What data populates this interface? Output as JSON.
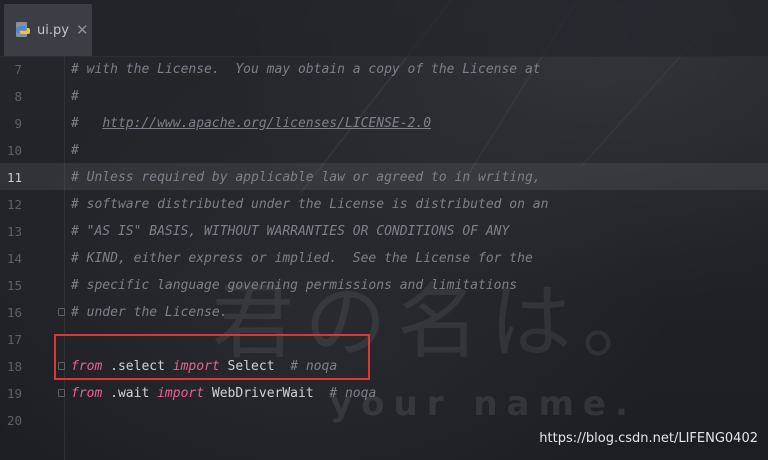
{
  "editor": {
    "tab": {
      "label": "ui.py",
      "close_glyph": "✕",
      "icon": "python-file-icon"
    },
    "current_line": 11,
    "lines": [
      {
        "num": "7",
        "tokens": [
          {
            "cls": "cm",
            "text": "# with the License.  You may obtain a copy of the License at"
          }
        ]
      },
      {
        "num": "8",
        "tokens": [
          {
            "cls": "cm",
            "text": "#"
          }
        ]
      },
      {
        "num": "9",
        "tokens": [
          {
            "cls": "cm",
            "text": "#   "
          },
          {
            "cls": "url",
            "text": "http://www.apache.org/licenses/LICENSE-2.0"
          }
        ]
      },
      {
        "num": "10",
        "tokens": [
          {
            "cls": "cm",
            "text": "#"
          }
        ]
      },
      {
        "num": "11",
        "tokens": [
          {
            "cls": "cm",
            "text": "# Unless required by applicable law or agreed to in writing,"
          }
        ]
      },
      {
        "num": "12",
        "tokens": [
          {
            "cls": "cm",
            "text": "# software distributed under the License is distributed on an"
          }
        ]
      },
      {
        "num": "13",
        "tokens": [
          {
            "cls": "cm",
            "text": "# \"AS IS\" BASIS, WITHOUT WARRANTIES OR CONDITIONS OF ANY"
          }
        ]
      },
      {
        "num": "14",
        "tokens": [
          {
            "cls": "cm",
            "text": "# KIND, either express or implied.  See the License for the"
          }
        ]
      },
      {
        "num": "15",
        "tokens": [
          {
            "cls": "cm",
            "text": "# specific language governing permissions and limitations"
          }
        ]
      },
      {
        "num": "16",
        "fold": true,
        "tokens": [
          {
            "cls": "cm",
            "text": "# under the License."
          }
        ]
      },
      {
        "num": "17",
        "tokens": []
      },
      {
        "num": "18",
        "fold": true,
        "tokens": [
          {
            "cls": "kw",
            "text": "from"
          },
          {
            "cls": "id",
            "text": " .select "
          },
          {
            "cls": "kw",
            "text": "import"
          },
          {
            "cls": "id",
            "text": " Select  "
          },
          {
            "cls": "cm",
            "text": "# noqa"
          }
        ]
      },
      {
        "num": "19",
        "fold": true,
        "tokens": [
          {
            "cls": "kw",
            "text": "from"
          },
          {
            "cls": "id",
            "text": " .wait "
          },
          {
            "cls": "kw",
            "text": "import"
          },
          {
            "cls": "id",
            "text": " WebDriverWait  "
          },
          {
            "cls": "cm",
            "text": "# noqa"
          }
        ]
      },
      {
        "num": "20",
        "tokens": []
      }
    ]
  },
  "overlay": {
    "highlight_color": "#e03535",
    "wallpaper_kanji": [
      "君",
      "の",
      "名",
      "は",
      "。"
    ],
    "wallpaper_subtitle": "your name.",
    "watermark": "https://blog.csdn.net/LIFENG0402"
  },
  "colors": {
    "background": "#1f2126",
    "comment": "#7d808a",
    "keyword": "#e8638d",
    "identifier": "#d0d2d8",
    "line_number": "#5d6068"
  }
}
